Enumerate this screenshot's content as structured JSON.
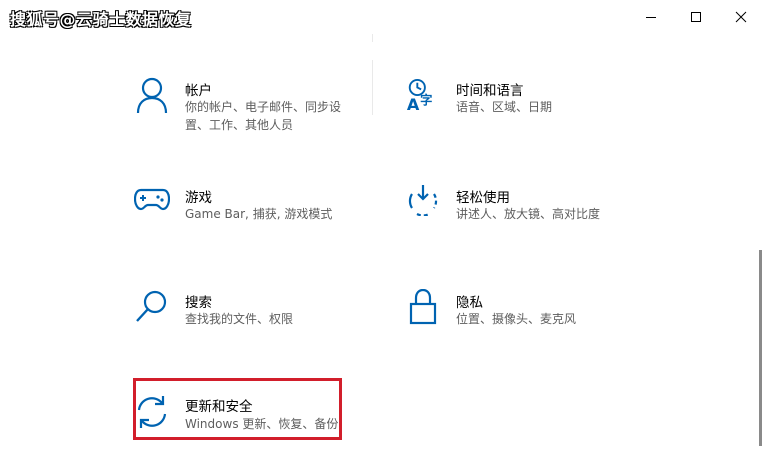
{
  "watermark": "搜狐号@云骑士数据恢复",
  "window_controls": {
    "minimize": "minimize",
    "maximize": "maximize",
    "close": "close"
  },
  "colors": {
    "accent": "#0063b1",
    "highlight": "#d21e2b"
  },
  "settings": [
    {
      "id": "accounts",
      "title": "帐户",
      "desc": [
        "你的帐户、电子邮件、同步设",
        "置、工作、其他人员"
      ],
      "icon": "person-icon"
    },
    {
      "id": "time-language",
      "title": "时间和语言",
      "desc": [
        "语音、区域、日期"
      ],
      "icon": "time-language-icon"
    },
    {
      "id": "gaming",
      "title": "游戏",
      "desc": [
        "Game Bar, 捕获, 游戏模式"
      ],
      "icon": "gamepad-icon"
    },
    {
      "id": "ease-of-access",
      "title": "轻松使用",
      "desc": [
        "讲述人、放大镜、高对比度"
      ],
      "icon": "ease-of-access-icon"
    },
    {
      "id": "search",
      "title": "搜索",
      "desc": [
        "查找我的文件、权限"
      ],
      "icon": "magnifier-icon"
    },
    {
      "id": "privacy",
      "title": "隐私",
      "desc": [
        "位置、摄像头、麦克风"
      ],
      "icon": "lock-icon"
    },
    {
      "id": "update-security",
      "title": "更新和安全",
      "desc": [
        "Windows 更新、恢复、备份"
      ],
      "icon": "sync-arrows-icon"
    }
  ]
}
